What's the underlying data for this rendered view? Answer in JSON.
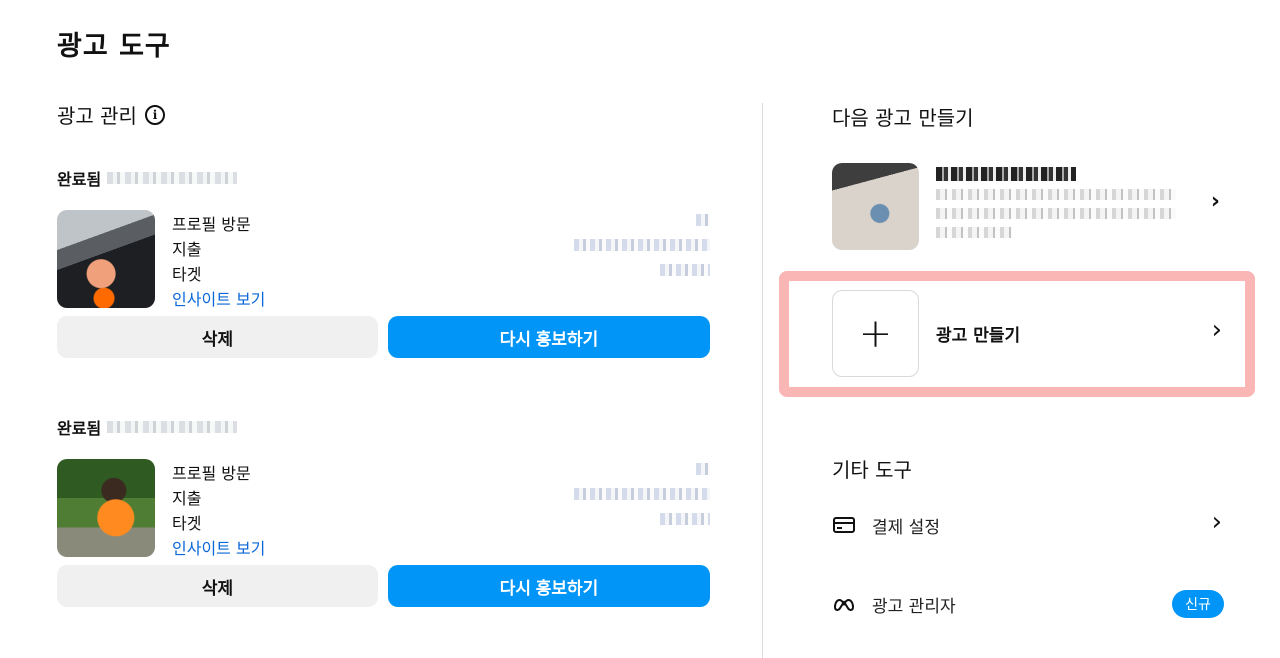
{
  "page": {
    "title": "광고 도구"
  },
  "manage": {
    "title": "광고 관리",
    "ads": [
      {
        "status": "완료됨",
        "metrics": {
          "profile_visits": "프로필 방문",
          "impressions": "지출",
          "target": "타겟"
        },
        "insight_link": "인사이트 보기",
        "delete_label": "삭제",
        "promote_label": "다시 홍보하기"
      },
      {
        "status": "완료됨",
        "metrics": {
          "profile_visits": "프로필 방문",
          "impressions": "지출",
          "target": "타겟"
        },
        "insight_link": "인사이트 보기",
        "delete_label": "삭제",
        "promote_label": "다시 홍보하기"
      }
    ]
  },
  "next": {
    "title": "다음 광고 만들기",
    "create_label": "광고 만들기"
  },
  "other": {
    "title": "기타 도구",
    "items": [
      {
        "label": "결제 설정",
        "icon": "card-icon"
      },
      {
        "label": "광고 관리자",
        "icon": "meta-icon",
        "badge": "신규"
      }
    ]
  },
  "colors": {
    "accent": "#0095f6",
    "link": "#0a67d8",
    "highlight": "#f67878"
  }
}
